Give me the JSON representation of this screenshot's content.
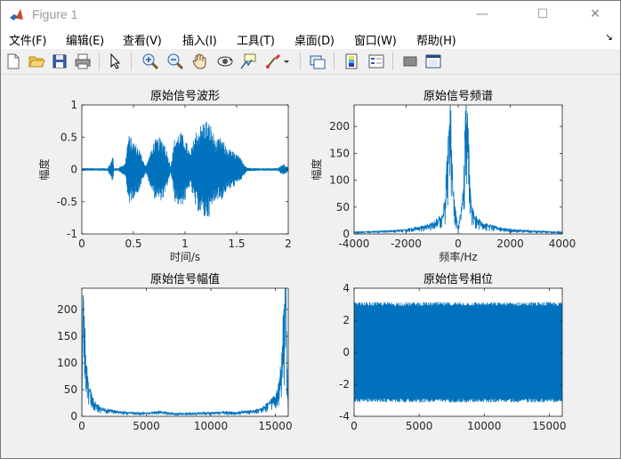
{
  "window": {
    "title": "Figure 1",
    "minimize_glyph": "—",
    "maximize_glyph": "☐",
    "close_glyph": "✕"
  },
  "menu": {
    "items": [
      "文件(F)",
      "编辑(E)",
      "查看(V)",
      "插入(I)",
      "工具(T)",
      "桌面(D)",
      "窗口(W)",
      "帮助(H)"
    ],
    "overflow_glyph": "↘"
  },
  "toolbar": {
    "icons": [
      "new-figure-icon",
      "open-file-icon",
      "save-icon",
      "print-icon",
      "edit-plot-arrow-icon",
      "zoom-in-icon",
      "zoom-out-icon",
      "pan-hand-icon",
      "rotate-3d-icon",
      "data-cursor-icon",
      "brush-icon",
      "brush-dropdown-icon",
      "link-plot-icon",
      "insert-colorbar-icon",
      "insert-legend-icon",
      "hide-plot-tools-icon",
      "show-plot-tools-icon"
    ]
  },
  "colors": {
    "line": "#0072BD",
    "axes_bg": "#ffffff",
    "figure_bg": "#f0f0f0"
  },
  "chart_data": [
    {
      "type": "line",
      "title": "原始信号波形",
      "xlabel": "时间/s",
      "ylabel": "幅度",
      "xlim": [
        0,
        2
      ],
      "ylim": [
        -1,
        1
      ],
      "xticks": [
        "0",
        "0.5",
        "1",
        "1.5",
        "2"
      ],
      "yticks": [
        "-1",
        "-0.5",
        "0",
        "0.5",
        "1"
      ],
      "grid": false,
      "series": [
        {
          "x": [
            0,
            0.1,
            0.25,
            0.29,
            0.3,
            0.31,
            0.35,
            0.42,
            0.45,
            0.5,
            0.55,
            0.62,
            0.7,
            0.75,
            0.8,
            0.86,
            0.9,
            0.95,
            1.0,
            1.05,
            1.1,
            1.15,
            1.2,
            1.25,
            1.3,
            1.35,
            1.4,
            1.45,
            1.5,
            1.55,
            1.6,
            1.7,
            1.8,
            1.9,
            1.95,
            2.0
          ],
          "envelope": [
            0.02,
            0.02,
            0.02,
            0.15,
            0.25,
            0.02,
            0.02,
            0.1,
            0.55,
            0.45,
            0.35,
            0.05,
            0.45,
            0.5,
            0.45,
            0.05,
            0.5,
            0.6,
            0.5,
            0.25,
            0.6,
            0.7,
            0.8,
            0.7,
            0.45,
            0.5,
            0.35,
            0.3,
            0.25,
            0.15,
            0.03,
            0.02,
            0.02,
            0.02,
            0.1,
            0.03
          ]
        }
      ]
    },
    {
      "type": "line",
      "title": "原始信号频谱",
      "xlabel": "频率/Hz",
      "ylabel": "幅度",
      "xlim": [
        -4000,
        4000
      ],
      "ylim": [
        0,
        240
      ],
      "xticks": [
        "-4000",
        "-2000",
        "0",
        "2000",
        "4000"
      ],
      "yticks": [
        "0",
        "50",
        "100",
        "150",
        "200"
      ],
      "grid": false,
      "series": [
        {
          "x": [
            -4000,
            -3500,
            -3000,
            -2500,
            -2000,
            -1500,
            -1000,
            -800,
            -600,
            -500,
            -400,
            -300,
            -200,
            -100,
            0,
            100,
            200,
            300,
            400,
            500,
            600,
            800,
            1000,
            1500,
            2000,
            2500,
            3000,
            3500,
            4000
          ],
          "y": [
            3,
            4,
            5,
            6,
            8,
            12,
            18,
            25,
            35,
            60,
            160,
            240,
            80,
            40,
            10,
            40,
            80,
            240,
            160,
            60,
            35,
            25,
            18,
            12,
            8,
            6,
            5,
            4,
            3
          ]
        }
      ]
    },
    {
      "type": "line",
      "title": "原始信号幅值",
      "xlabel": "",
      "ylabel": "",
      "xlim": [
        0,
        16000
      ],
      "ylim": [
        0,
        240
      ],
      "xticks": [
        "0",
        "5000",
        "10000",
        "15000"
      ],
      "yticks": [
        "0",
        "50",
        "100",
        "150",
        "200"
      ],
      "grid": false,
      "series": [
        {
          "x": [
            0,
            100,
            200,
            400,
            600,
            800,
            1000,
            1500,
            2000,
            3000,
            4000,
            5000,
            6000,
            7000,
            8000,
            9000,
            10000,
            11000,
            12000,
            13000,
            14000,
            14500,
            15000,
            15200,
            15400,
            15600,
            15800,
            15900,
            16000
          ],
          "y": [
            10,
            240,
            160,
            80,
            50,
            35,
            25,
            15,
            12,
            8,
            7,
            6,
            9,
            6,
            5,
            6,
            7,
            8,
            7,
            10,
            15,
            25,
            35,
            50,
            80,
            160,
            240,
            100,
            10
          ]
        }
      ]
    },
    {
      "type": "line",
      "title": "原始信号相位",
      "xlabel": "",
      "ylabel": "",
      "xlim": [
        0,
        16000
      ],
      "ylim": [
        -4,
        4
      ],
      "xticks": [
        "0",
        "5000",
        "10000",
        "15000"
      ],
      "yticks": [
        "-4",
        "-2",
        "0",
        "2",
        "4"
      ],
      "grid": false,
      "series": [
        {
          "x": [
            0,
            16000
          ],
          "band": [
            -3.14,
            3.14
          ]
        }
      ]
    }
  ]
}
